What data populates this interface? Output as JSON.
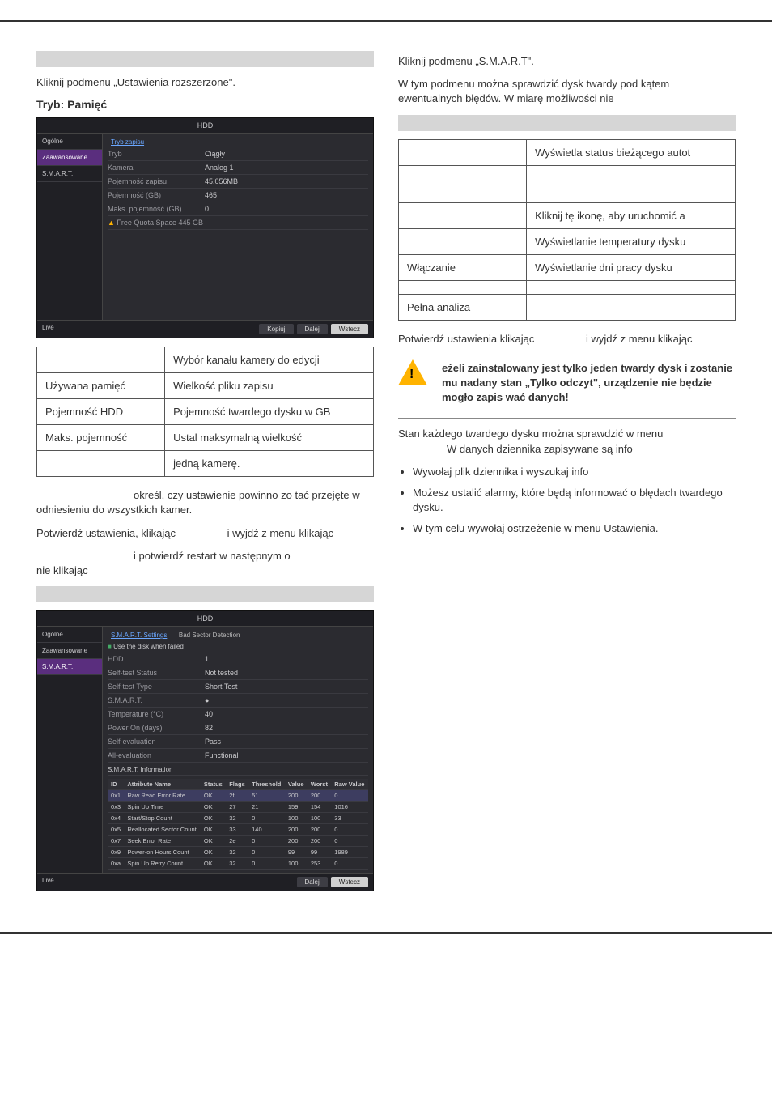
{
  "left": {
    "intro": "Kliknij podmenu „Ustawienia rozszerzone\".",
    "mode_title": "Tryb: Pamięć",
    "ss1": {
      "title": "HDD",
      "side": [
        "Ogólne",
        "Zaawansowane",
        "S.M.A.R.T."
      ],
      "tab": "Tryb zapisu",
      "rows": [
        {
          "l": "Tryb",
          "v": "Ciągły"
        },
        {
          "l": "Kamera",
          "v": "Analog 1"
        },
        {
          "l": "Pojemność zapisu",
          "v": "45.056MB"
        },
        {
          "l": "Pojemność (GB)",
          "v": "465"
        },
        {
          "l": "Maks. pojemność (GB)",
          "v": "0"
        },
        {
          "l": "Free Quota Space 445 GB",
          "v": "",
          "warn": true
        }
      ],
      "live": "Live",
      "btns": [
        "Kopiuj",
        "Dalej",
        "Wstecz"
      ]
    },
    "table1": [
      {
        "l": "",
        "v": "Wybór kanału kamery do edycji"
      },
      {
        "l": "Używana pamięć",
        "v": "Wielkość pliku zapisu"
      },
      {
        "l": "Pojemność HDD",
        "v": "Pojemność twardego dysku w GB"
      },
      {
        "l": "Maks. pojemność",
        "v": "Ustal maksymalną wielkość"
      },
      {
        "l": "",
        "v": "jedną kamerę."
      }
    ],
    "p1a": "określ, czy ustawienie powinno zo",
    "p1b": "tać przejęte w odniesieniu do wszystkich kamer.",
    "p2a": "Potwierdź ustawienia, klikając",
    "p2b": "i wyjdź z menu klikając",
    "p3a": "i potwierdź restart w następnym o",
    "p3b": "nie klikając",
    "ss2": {
      "title": "HDD",
      "side": [
        "Ogólne",
        "Zaawansowane",
        "S.M.A.R.T."
      ],
      "tabs": [
        "S.M.A.R.T. Settings",
        "Bad Sector Detection"
      ],
      "check": "Use the disk when failed",
      "info_rows": [
        {
          "l": "HDD",
          "v": "1"
        },
        {
          "l": "Self-test Status",
          "v": "Not tested"
        },
        {
          "l": "Self-test Type",
          "v": "Short Test"
        },
        {
          "l": "S.M.A.R.T.",
          "v": "●"
        },
        {
          "l": "Temperature (°C)",
          "v": "40"
        },
        {
          "l": "Power On (days)",
          "v": "82"
        },
        {
          "l": "Self-evaluation",
          "v": "Pass"
        },
        {
          "l": "All-evaluation",
          "v": "Functional"
        }
      ],
      "section": "S.M.A.R.T. Information",
      "headers": [
        "ID",
        "Attribute Name",
        "Status",
        "Flags",
        "Threshold",
        "Value",
        "Worst",
        "Raw Value"
      ],
      "rows": [
        [
          "0x1",
          "Raw Read Error Rate",
          "OK",
          "2f",
          "51",
          "200",
          "200",
          "0"
        ],
        [
          "0x3",
          "Spin Up Time",
          "OK",
          "27",
          "21",
          "159",
          "154",
          "1016"
        ],
        [
          "0x4",
          "Start/Stop Count",
          "OK",
          "32",
          "0",
          "100",
          "100",
          "33"
        ],
        [
          "0x5",
          "Reallocated Sector Count",
          "OK",
          "33",
          "140",
          "200",
          "200",
          "0"
        ],
        [
          "0x7",
          "Seek Error Rate",
          "OK",
          "2e",
          "0",
          "200",
          "200",
          "0"
        ],
        [
          "0x9",
          "Power-on Hours Count",
          "OK",
          "32",
          "0",
          "99",
          "99",
          "1989"
        ],
        [
          "0xa",
          "Spin Up Retry Count",
          "OK",
          "32",
          "0",
          "100",
          "253",
          "0"
        ]
      ],
      "live": "Live",
      "btns": [
        "Dalej",
        "Wstecz"
      ]
    }
  },
  "right": {
    "intro1": "Kliknij podmenu „S.M.A.R.T\".",
    "intro2": "W tym podmenu można sprawdzić dysk twardy pod kątem ewentualnych błędów. W miarę możliwości nie",
    "table": [
      {
        "l": "",
        "v": "Wyświetla status bieżącego autot"
      },
      {
        "l": "",
        "v": ""
      },
      {
        "l": "",
        "v": "Kliknij tę ikonę, aby uruchomić a"
      },
      {
        "l": "",
        "v": "Wyświetlanie temperatury dysku"
      },
      {
        "l": "Włączanie",
        "v": "Wyświetlanie dni pracy dysku"
      },
      {
        "l": "",
        "v": ""
      },
      {
        "l": "Pełna analiza",
        "v": ""
      }
    ],
    "p1a": "Potwierdź ustawienia klikając",
    "p1b": "i wyjdź z menu klikając",
    "warn": "eżeli zainstalowany jest tylko jeden twardy dysk i zostanie mu nadany stan „Tylko odczyt\", urządzenie nie będzie mogło zapis wać danych!",
    "p2": "Stan każdego twardego dysku można sprawdzić w menu",
    "p2b": "W danych dziennika zapisywane są info",
    "bul1": "Wywołaj plik dziennika i wyszukaj info",
    "bul2": "Możesz ustalić alarmy, które będą informować o błędach twardego dysku.",
    "bul3": "W tym celu wywołaj ostrzeżenie w menu Ustawienia."
  }
}
